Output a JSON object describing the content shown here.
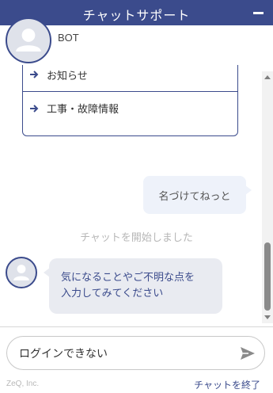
{
  "header": {
    "title": "チャットサポート",
    "minimize_icon": "minimize-icon"
  },
  "bot": {
    "name": "BOT",
    "avatar_icon": "user-avatar-icon"
  },
  "menu": {
    "items": [
      {
        "label": "お知らせ",
        "icon": "arrow-right-icon"
      },
      {
        "label": "工事・故障情報",
        "icon": "arrow-right-icon"
      }
    ]
  },
  "messages": {
    "user_message": "名づけてねっと",
    "system_message": "チャットを開始しました",
    "bot_message_line1": "気になることやご不明な点を",
    "bot_message_line2": "入力してみてください"
  },
  "input": {
    "value": "ログインできない",
    "send_icon": "send-icon"
  },
  "footer": {
    "brand": "ZeQ, Inc.",
    "end_chat": "チャットを終了"
  },
  "colors": {
    "primary": "#3b4b8c",
    "bubble_user": "#eef2fa",
    "bubble_bot": "#e9ebf1"
  }
}
